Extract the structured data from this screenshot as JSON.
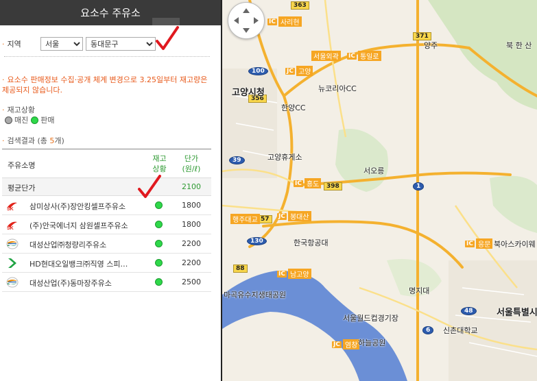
{
  "panel": {
    "title": "요소수 주유소",
    "region_label": "지역",
    "city_selected": "서울",
    "district_selected": "동대문구",
    "notice": "요소수 판매정보 수집·공개 체계 변경으로 3.25일부터 재고량은 제공되지 않습니다.",
    "stock_status_label": "재고상황",
    "legend_soldout": "매진",
    "legend_onsale": "판매",
    "result_prefix": "검색결과 (총 ",
    "result_count": "5",
    "result_suffix": "개)",
    "table": {
      "col_name": "주유소명",
      "col_stock_1": "재고",
      "col_stock_2": "상황",
      "col_price_1": "단가",
      "col_price_2": "(원/ℓ)",
      "avg_label": "평균단가",
      "avg_price": "2100",
      "rows": [
        {
          "logo": "sk-logo",
          "name": "삼미상사(주)장안킹셀프주유소",
          "status": "판매",
          "price": "1800"
        },
        {
          "logo": "sk-logo",
          "name": "(주)안국에너지 삼원셀프주유소",
          "status": "판매",
          "price": "1800"
        },
        {
          "logo": "gs-logo",
          "name": "대성산업㈜청량리주유소",
          "status": "판매",
          "price": "2200"
        },
        {
          "logo": "hd-logo",
          "name": "HD현대오일뱅크㈜직영 스피…",
          "status": "판매",
          "price": "2200"
        },
        {
          "logo": "gs-logo",
          "name": "대성산업(주)동마장주유소",
          "status": "판매",
          "price": "2500"
        }
      ]
    }
  },
  "map": {
    "labels": {
      "goyang_city": "고양시청",
      "newkorea_cc": "뉴코리아CC",
      "hanyang_cc": "한양CC",
      "goyang_rest": "고양휴게소",
      "seooreung": "서오릉",
      "korea_aero": "한국항공대",
      "myongji": "명지대",
      "bukahyeon": "북아스카이웨",
      "bukhansan": "북 한 산",
      "magok_park": "마곡유수지생태공원",
      "worldcup": "서울월드컵경기장",
      "sinchon_univ": "신촌대학교",
      "seoul_city": "서울특별시",
      "haneul_park": "하늘공원",
      "yangju": "양주"
    },
    "junctions": {
      "sariheon": "사리현",
      "seoul_ok": "서울외곽",
      "tongilro": "통일로",
      "goyang": "고양",
      "heungdo": "흥도",
      "haengju": "행주대교",
      "bongdaesan": "봉대산",
      "namgoyang": "남고양",
      "yeomchang": "염창",
      "eunpyeong": "응문"
    },
    "routes": [
      "363",
      "371",
      "100",
      "356",
      "39",
      "398",
      "1",
      "57",
      "130",
      "88",
      "48",
      "6"
    ]
  },
  "colors": {
    "header_bg": "#3a3a3a",
    "accent_orange": "#e8711a",
    "notice_red": "#e85a1b",
    "stock_green": "#2e9a32",
    "onsale_dot": "#2fd84a",
    "check_red": "#e0191f",
    "river": "#6b8fd6"
  }
}
